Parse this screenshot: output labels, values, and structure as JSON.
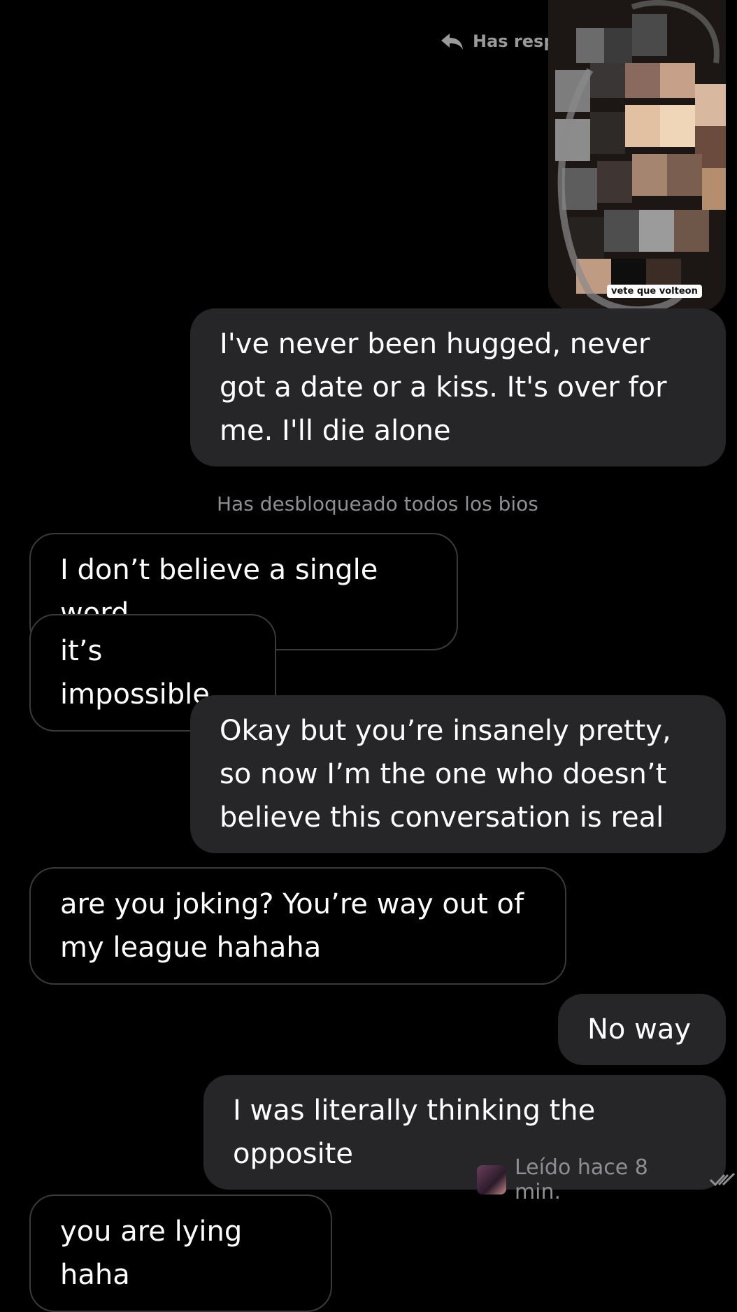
{
  "reply_header": {
    "text": "Has respondido a",
    "icon": "reply-arrow-icon"
  },
  "story": {
    "caption_text": "vete que volteon"
  },
  "messages": [
    {
      "side": "sent",
      "text": "I've never been hugged, never got a date or a kiss. It's over for me. I'll die alone"
    },
    {
      "side": "system",
      "text": "Has desbloqueado todos los bios"
    },
    {
      "side": "received",
      "text": "I don’t believe a single word"
    },
    {
      "side": "received",
      "text": "it’s impossible"
    },
    {
      "side": "sent",
      "text": "Okay but you’re insanely pretty, so now I’m the one who doesn’t believe this conversation is real"
    },
    {
      "side": "received",
      "text": "are you joking? You’re way out of my league hahaha"
    },
    {
      "side": "sent",
      "text": "No way"
    },
    {
      "side": "sent",
      "text": "I was literally thinking the opposite"
    },
    {
      "side": "received",
      "text": "you are lying haha"
    }
  ],
  "read_receipt": {
    "text": "Leído hace 8 min.",
    "icon": "double-check-icon"
  },
  "colors": {
    "background": "#000000",
    "sent_bubble": "#262628",
    "received_border": "#3a3a3c",
    "muted_text": "#8e8e93"
  }
}
